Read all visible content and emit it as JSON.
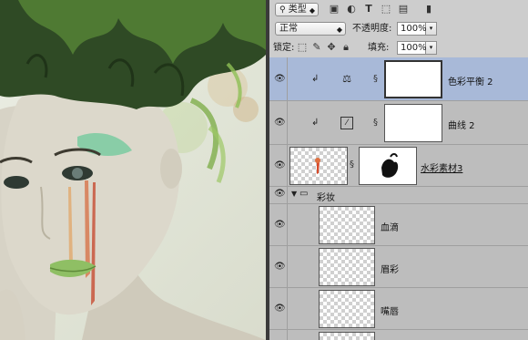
{
  "toolbar_row1": {
    "filter_label": "类型"
  },
  "toolbar_row2": {
    "blend_mode": "正常",
    "opacity_label": "不透明度:",
    "opacity_value": "100%"
  },
  "toolbar_row3": {
    "lock_label": "锁定:",
    "fill_label": "填充:",
    "fill_value": "100%"
  },
  "layers": [
    {
      "name": "色彩平衡 2",
      "type": "adjustment",
      "adjustment_icon": "balance-scale-icon",
      "selected": true
    },
    {
      "name": "曲线 2",
      "type": "adjustment",
      "adjustment_icon": "curves-icon",
      "selected": false
    },
    {
      "name": "水彩素材3",
      "type": "image",
      "selected": false
    },
    {
      "name": "彩妆",
      "type": "group",
      "selected": false
    },
    {
      "name": "血滴",
      "type": "image",
      "selected": false
    },
    {
      "name": "眉彩",
      "type": "image",
      "selected": false
    },
    {
      "name": "嘴唇",
      "type": "image",
      "selected": false
    }
  ],
  "colors": {
    "selection": "#a8b9d8",
    "panel": "#bdbdbd"
  }
}
